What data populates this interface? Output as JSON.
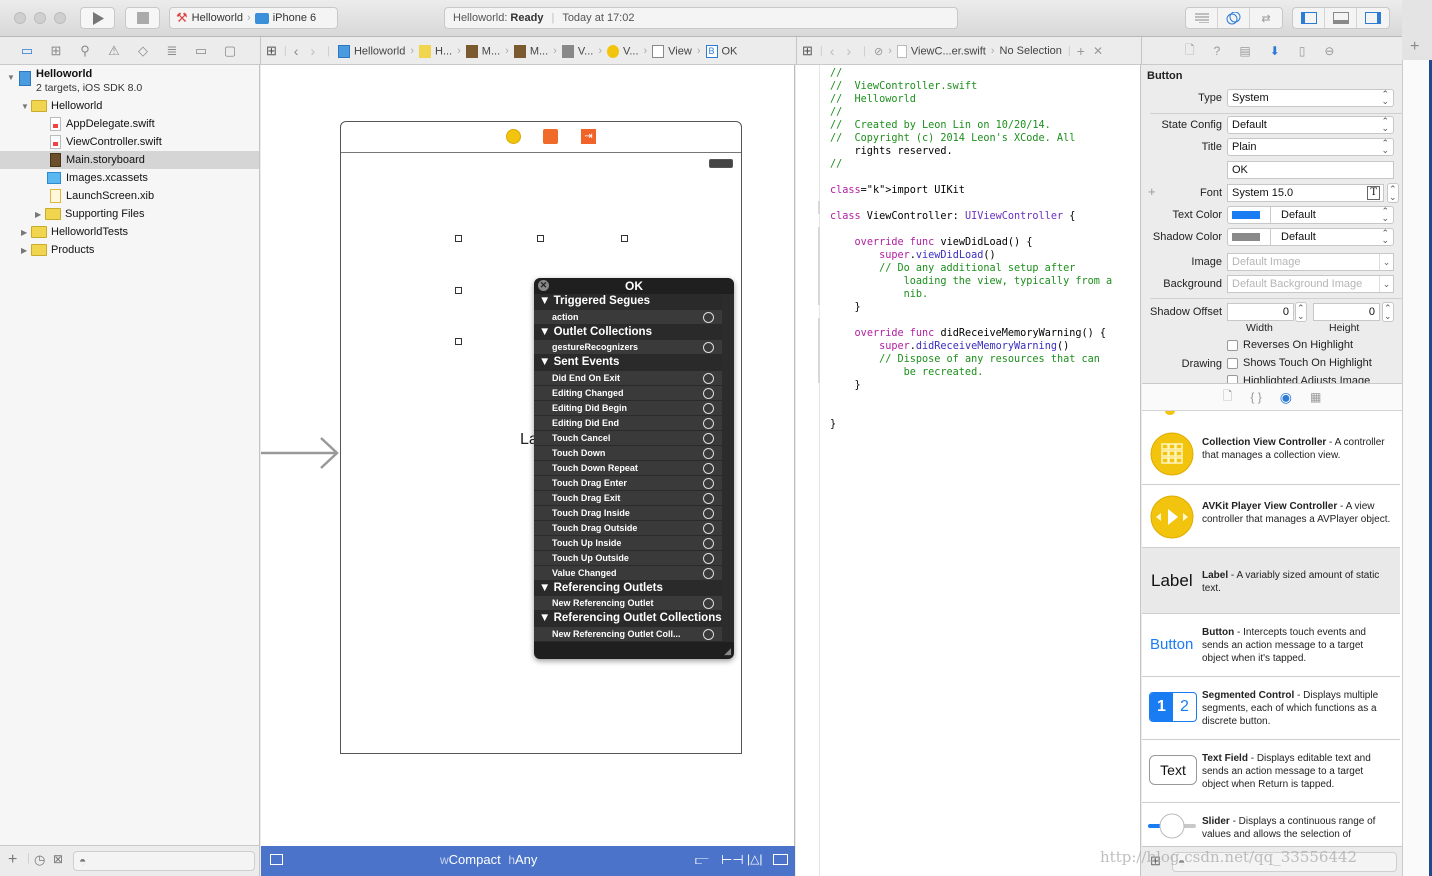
{
  "toolbar": {
    "scheme_project": "Helloworld",
    "scheme_device": "iPhone 6",
    "status_project": "Helloworld:",
    "status_state": "Ready",
    "status_time": "Today at 17:02"
  },
  "jumpbar_left": {
    "items": [
      "Helloworld",
      "H...",
      "M...",
      "M...",
      "V...",
      "V...",
      "View",
      "OK"
    ]
  },
  "jumpbar_right": {
    "file": "ViewC...er.swift",
    "selection": "No Selection"
  },
  "navigator": {
    "project_name": "Helloworld",
    "project_sub": "2 targets, iOS SDK 8.0",
    "items": [
      {
        "label": "Helloworld",
        "kind": "folder"
      },
      {
        "label": "AppDelegate.swift",
        "kind": "swift"
      },
      {
        "label": "ViewController.swift",
        "kind": "swift"
      },
      {
        "label": "Main.storyboard",
        "kind": "storyboard",
        "selected": true
      },
      {
        "label": "Images.xcassets",
        "kind": "assets"
      },
      {
        "label": "LaunchScreen.xib",
        "kind": "xib"
      },
      {
        "label": "Supporting Files",
        "kind": "folder"
      },
      {
        "label": "HelloworldTests",
        "kind": "folder"
      },
      {
        "label": "Products",
        "kind": "folder"
      }
    ]
  },
  "canvas": {
    "label_partial": "La",
    "size_class_w_prefix": "w",
    "size_class_w": "Compact",
    "size_class_h_prefix": "h",
    "size_class_h": "Any"
  },
  "connections_popup": {
    "title": "OK",
    "sections": [
      {
        "header": "Triggered Segues",
        "items": [
          "action"
        ]
      },
      {
        "header": "Outlet Collections",
        "items": [
          "gestureRecognizers"
        ]
      },
      {
        "header": "Sent Events",
        "items": [
          "Did End On Exit",
          "Editing Changed",
          "Editing Did Begin",
          "Editing Did End",
          "Touch Cancel",
          "Touch Down",
          "Touch Down Repeat",
          "Touch Drag Enter",
          "Touch Drag Exit",
          "Touch Drag Inside",
          "Touch Drag Outside",
          "Touch Up Inside",
          "Touch Up Outside",
          "Value Changed"
        ]
      },
      {
        "header": "Referencing Outlets",
        "items": [
          "New Referencing Outlet"
        ]
      },
      {
        "header": "Referencing Outlet Collections",
        "items": [
          "New Referencing Outlet Coll..."
        ]
      }
    ]
  },
  "code_lines": [
    "//",
    "//  ViewController.swift",
    "//  Helloworld",
    "//",
    "//  Created by Leon Lin on 10/20/14.",
    "//  Copyright (c) 2014 Leon's XCode. All",
    "    rights reserved.",
    "//",
    "",
    "import UIKit",
    "",
    "class ViewController: UIViewController {",
    "",
    "    override func viewDidLoad() {",
    "        super.viewDidLoad()",
    "        // Do any additional setup after",
    "            loading the view, typically from a",
    "            nib.",
    "    }",
    "",
    "    override func didReceiveMemoryWarning() {",
    "        super.didReceiveMemoryWarning()",
    "        // Dispose of any resources that can",
    "            be recreated.",
    "    }",
    "",
    "",
    "}"
  ],
  "inspector": {
    "section_title": "Button",
    "type_label": "Type",
    "type_value": "System",
    "state_config_label": "State Config",
    "state_config_value": "Default",
    "title_label": "Title",
    "title_value": "Plain",
    "title_text": "OK",
    "font_label": "Font",
    "font_value": "System 15.0",
    "text_color_label": "Text Color",
    "text_color_value": "Default",
    "text_color_swatch": "#1a7cf2",
    "shadow_color_label": "Shadow Color",
    "shadow_color_value": "Default",
    "shadow_color_swatch": "#8a8a8a",
    "image_label": "Image",
    "image_placeholder": "Default Image",
    "background_label": "Background",
    "background_placeholder": "Default Background Image",
    "shadow_offset_label": "Shadow Offset",
    "shadow_offset_width": "0",
    "shadow_offset_height": "0",
    "width_caption": "Width",
    "height_caption": "Height",
    "drawing_label": "Drawing",
    "reverses_on_highlight": "Reverses On Highlight",
    "shows_touch_on_highlight": "Shows Touch On Highlight",
    "highlighted_adjusts_image": "Highlighted Adjusts Image"
  },
  "library": {
    "items": [
      {
        "title": "Collection View Controller",
        "desc": " - A controller that manages a collection view."
      },
      {
        "title": "AVKit Player View Controller",
        "desc": " - A view controller that manages a AVPlayer object."
      },
      {
        "title": "Label",
        "desc": " - A variably sized amount of static text.",
        "icon_text": "Label"
      },
      {
        "title": "Button",
        "desc": " - Intercepts touch events and sends an action message to a target object when it's tapped.",
        "icon_text": "Button"
      },
      {
        "title": "Segmented Control",
        "desc": " - Displays multiple segments, each of which functions as a discrete button.",
        "seg1": "1",
        "seg2": "2"
      },
      {
        "title": "Text Field",
        "desc": " - Displays editable text and sends an action message to a target object when Return is tapped.",
        "icon_text": "Text"
      },
      {
        "title": "Slider",
        "desc": " - Displays a continuous range of values and allows the selection of"
      }
    ]
  },
  "watermark": "http://blog.csdn.net/qq_33556442"
}
